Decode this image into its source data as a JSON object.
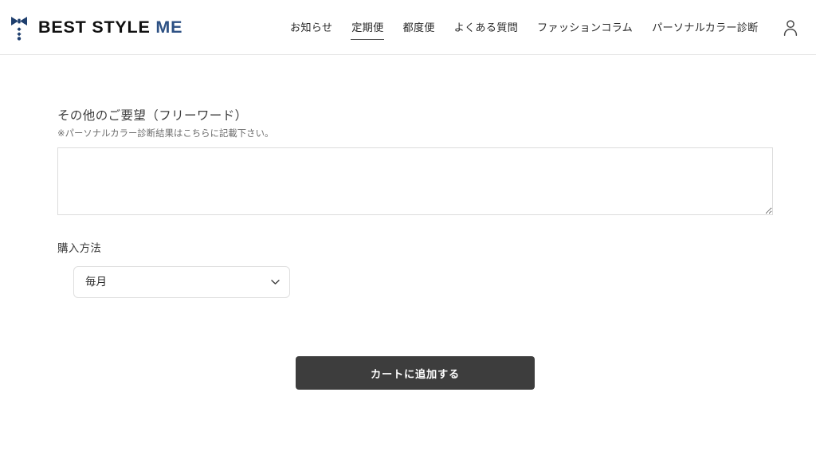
{
  "header": {
    "brand": {
      "logo_icon": "bowtie-logo-icon",
      "text_primary": "BEST STYLE",
      "text_accent": "ME",
      "accent_color": "#2d5184",
      "primary_color": "#101010"
    },
    "nav": [
      {
        "label": "お知らせ",
        "active": false
      },
      {
        "label": "定期便",
        "active": true
      },
      {
        "label": "都度便",
        "active": false
      },
      {
        "label": "よくある質問",
        "active": false
      },
      {
        "label": "ファッションコラム",
        "active": false
      },
      {
        "label": "パーソナルカラー診断",
        "active": false
      }
    ],
    "account": {
      "icon": "account-person-icon",
      "label": "アカウント"
    },
    "border_color": "#e6e6e6"
  },
  "main": {
    "freeword": {
      "label": "その他のご要望（フリーワード）",
      "note": "※パーソナルカラー診断結果はこちらに記載下さい。",
      "value": "",
      "placeholder": ""
    },
    "purchase_method": {
      "label": "購入方法",
      "selected": "毎月",
      "options": [
        "毎月"
      ],
      "chevron_icon": "chevron-down-icon"
    },
    "submit": {
      "label": "カートに追加する",
      "background_color": "#3d3d3d",
      "text_color": "#ffffff"
    }
  }
}
